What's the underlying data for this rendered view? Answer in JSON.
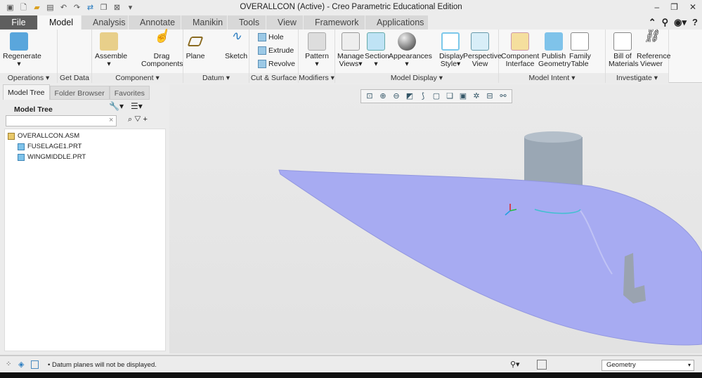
{
  "window": {
    "title": "OVERALLCON (Active) - Creo Parametric Educational Edition",
    "controls": [
      "–",
      "❐",
      "✕"
    ]
  },
  "quick_access": [
    "app-icon",
    "new-icon",
    "open-icon",
    "save-icon",
    "undo-icon",
    "redo-icon",
    "regenerate-icon",
    "windows-icon",
    "close-window-icon",
    "customize-icon"
  ],
  "tabs": [
    {
      "label": "File"
    },
    {
      "label": "Model",
      "active": true
    },
    {
      "label": "Analysis"
    },
    {
      "label": "Annotate"
    },
    {
      "label": "Manikin"
    },
    {
      "label": "Tools"
    },
    {
      "label": "View"
    },
    {
      "label": "Framework"
    },
    {
      "label": "Applications"
    }
  ],
  "ribbon": {
    "groups": [
      {
        "label": "Operations ▾",
        "buttons": [
          "Regenerate"
        ]
      },
      {
        "label": "Get Data ▾"
      },
      {
        "label": "Component ▾",
        "buttons": [
          "Assemble",
          "Drag Components"
        ]
      },
      {
        "label": "Datum ▾",
        "buttons": [
          "Plane",
          "Sketch"
        ]
      },
      {
        "label": "Cut & Surface ▾",
        "buttons": [
          "Hole",
          "Extrude",
          "Revolve"
        ]
      },
      {
        "label": "Modifiers ▾",
        "buttons": [
          "Pattern"
        ]
      },
      {
        "label": "Model Display ▾",
        "buttons": [
          "Manage Views",
          "Section",
          "Appearances",
          "Display Style",
          "Perspective View"
        ]
      },
      {
        "label": "Model Intent ▾",
        "buttons": [
          "Component Interface",
          "Publish Geometry",
          "Family Table"
        ]
      },
      {
        "label": "Investigate ▾",
        "buttons": [
          "Bill of Materials",
          "Reference Viewer"
        ]
      }
    ]
  },
  "panel": {
    "tabs": [
      "Model Tree",
      "Folder Browser",
      "Favorites"
    ],
    "heading": "Model Tree",
    "search_value": "",
    "items": [
      {
        "label": "OVERALLCON.ASM",
        "type": "assembly"
      },
      {
        "label": "FUSELAGE1.PRT",
        "type": "part"
      },
      {
        "label": "WINGMIDDLE.PRT",
        "type": "part"
      }
    ]
  },
  "status": {
    "message": "• Datum planes will not be displayed.",
    "filter": "Geometry"
  },
  "colors": {
    "model_body": "#a7abf2",
    "cylinder": "#9aa7b4",
    "file_tab": "#5e5e5e"
  }
}
